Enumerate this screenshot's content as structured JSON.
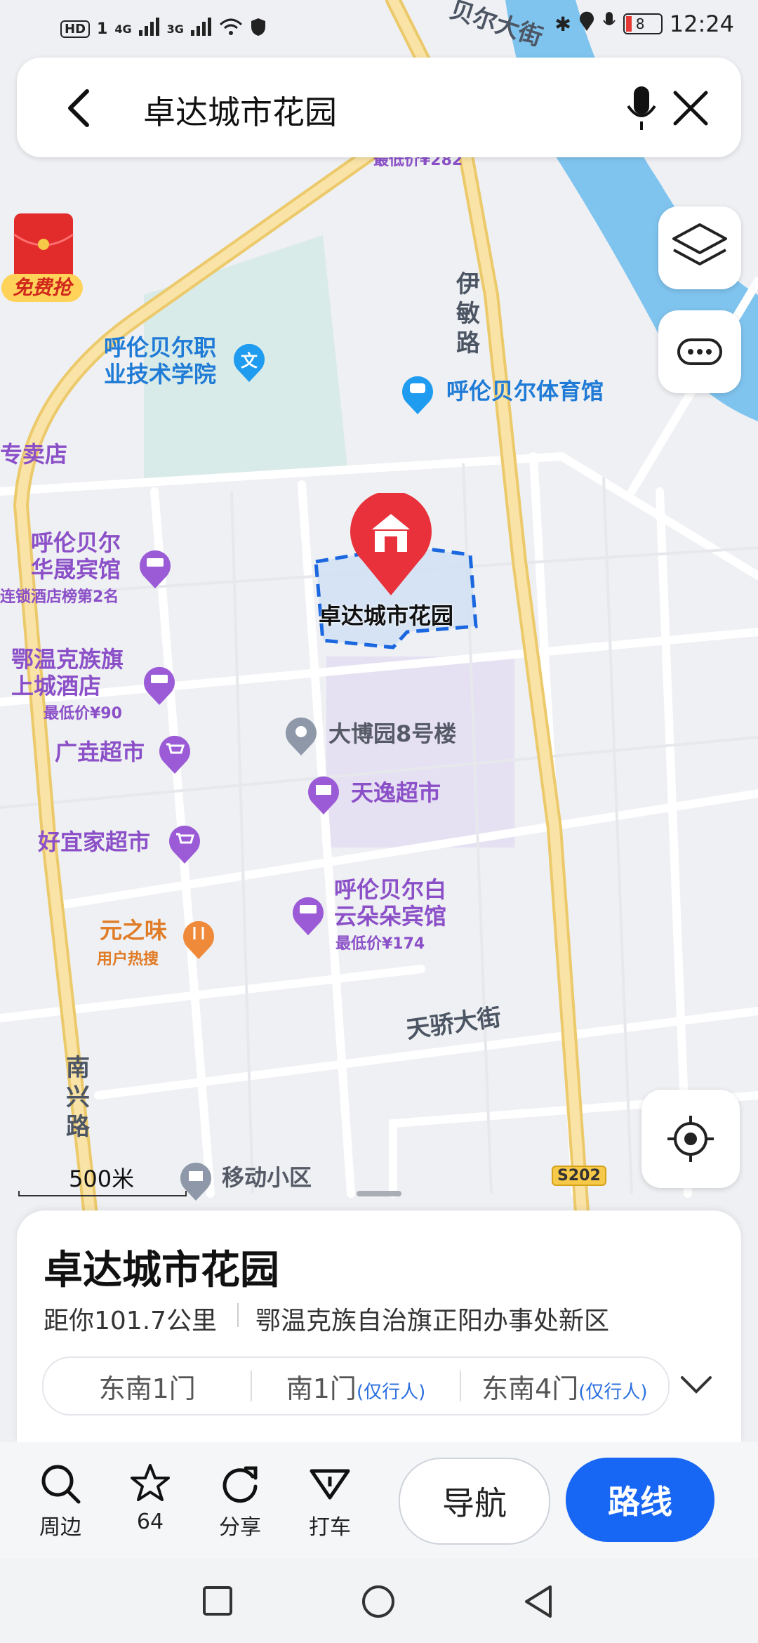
{
  "status_bar": {
    "hd": "HD",
    "sim1": "1",
    "net1": "4G",
    "net2": "3G",
    "battery": "8",
    "time": "12:24"
  },
  "search": {
    "query": "卓达城市花园"
  },
  "promo": {
    "label": "免费抢"
  },
  "map": {
    "pois": {
      "college": "呼伦贝尔职\n业技术学院",
      "stadium": "呼伦贝尔体育馆",
      "shop_left": "专卖店",
      "hotel1_name": "呼伦贝尔\n华晟宾馆",
      "hotel1_sub": "连锁酒店榜第2名",
      "hotel2_name": "鄂温克族旗\n上城酒店",
      "hotel2_price": "最低价¥90",
      "top_price": "最低价¥282",
      "market1": "广垚超市",
      "market2": "好宜家超市",
      "restaurant_name": "元之味",
      "restaurant_sub": "用户热搜",
      "building": "大博园8号楼",
      "market3": "天逸超市",
      "hotel3_name": "呼伦贝尔白\n云朵朵宾馆",
      "hotel3_price": "最低价¥174",
      "selected": "卓达城市花园",
      "community": "移动小区"
    },
    "streets": {
      "yimin": "伊\n敏\n路",
      "tianjiao": "天骄大街",
      "nanxing": "南\n兴\n路",
      "beier": "贝尔大街",
      "highway": "S202"
    },
    "scale": "500米"
  },
  "card": {
    "title": "卓达城市花园",
    "distance": "距你101.7公里",
    "area": "鄂温克族自治旗正阳办事处新区",
    "gates": [
      {
        "name": "东南1门",
        "tag": ""
      },
      {
        "name": "南1门",
        "tag": "(仅行人)"
      },
      {
        "name": "东南4门",
        "tag": "(仅行人)"
      }
    ]
  },
  "actions": {
    "nearby": "周边",
    "favorite_count": "64",
    "share": "分享",
    "taxi": "打车",
    "navigate": "导航",
    "route": "路线"
  },
  "colors": {
    "primary": "#1766f4",
    "poi_purple": "#8b4fc8",
    "poi_blue": "#1f7bd6",
    "pin_red": "#e8313b",
    "road_yellow": "#f6d98a"
  }
}
